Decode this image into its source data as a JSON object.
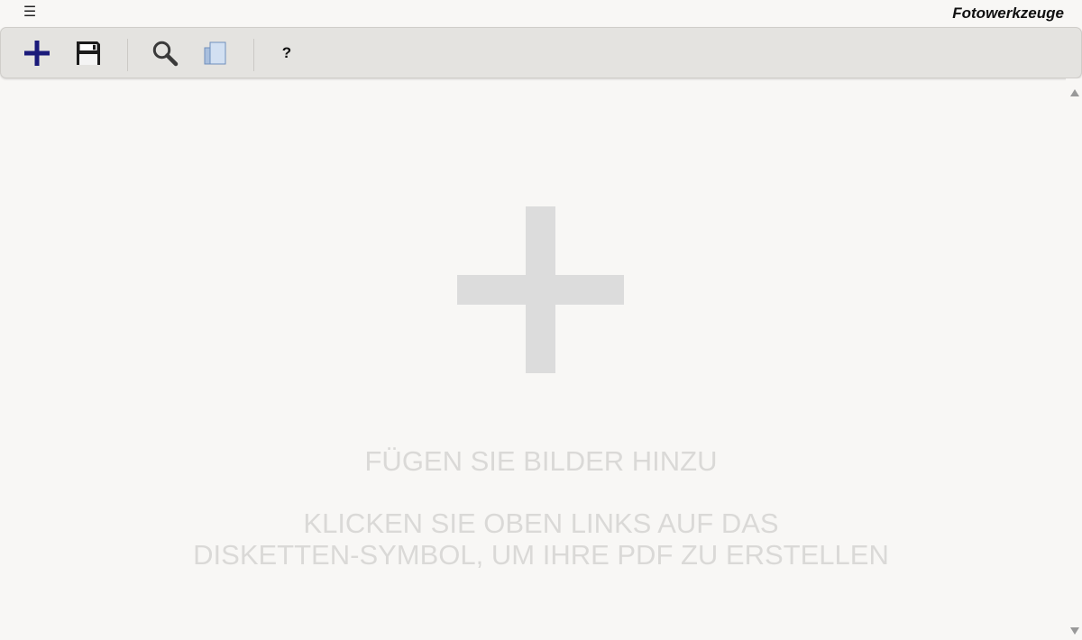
{
  "window": {
    "menu_icon": "☰",
    "title": "Fotowerkzeuge"
  },
  "toolbar": {
    "add_icon": "plus-icon",
    "save_icon": "floppy-disk-icon",
    "zoom_icon": "magnifier-icon",
    "pages_icon": "pages-icon",
    "help_label": "?"
  },
  "empty_state": {
    "add_icon": "plus-icon",
    "title": "FÜGEN SIE BILDER HINZU",
    "instruction_line1": "KLICKEN SIE OBEN LINKS AUF DAS",
    "instruction_line2": "DISKETTEN-SYMBOL, UM IHRE PDF ZU ERSTELLEN"
  },
  "colors": {
    "accent_plus": "#1a1a7a",
    "toolbar_bg": "#e4e3e0",
    "background": "#f8f7f5",
    "hint_text": "#dad9d7"
  }
}
